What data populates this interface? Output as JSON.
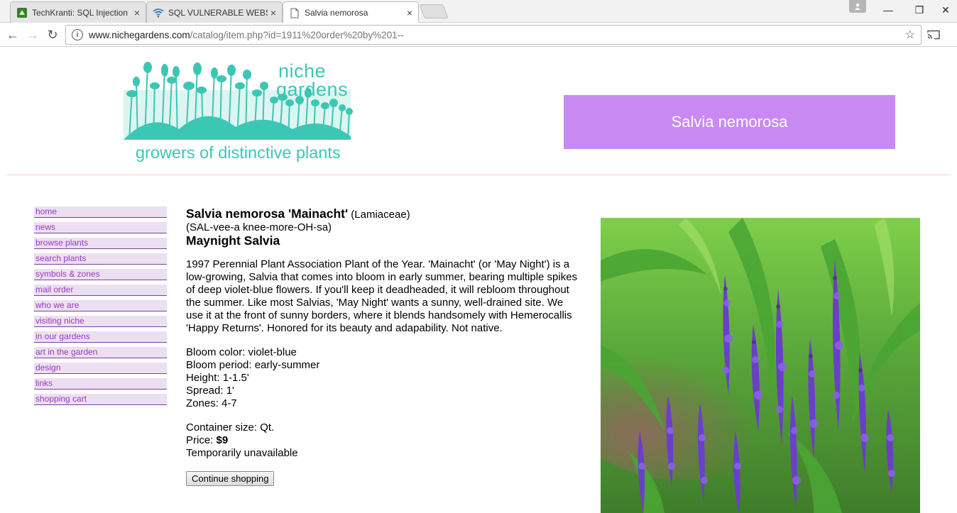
{
  "browser": {
    "tabs": [
      {
        "title": "TechKranti: SQL Injection",
        "close": "×",
        "active": false
      },
      {
        "title": "SQL VULNERABLE WEBSI",
        "close": "×",
        "active": false
      },
      {
        "title": "Salvia nemorosa",
        "close": "×",
        "active": true
      }
    ],
    "window_controls": {
      "minimize": "—",
      "restore": "❐",
      "close": "✕"
    },
    "nav": {
      "back": "←",
      "forward": "→",
      "reload": "↻"
    },
    "address": {
      "domain": "www.nichegardens.com",
      "path": "/catalog/item.php?id=1911%20order%20by%201--"
    },
    "bookmark_star": "☆"
  },
  "site": {
    "logo_name_line1": "niche",
    "logo_name_line2": "gardens",
    "logo_tagline": "growers of distinctive plants",
    "header_title": "Salvia nemorosa",
    "nav": [
      "home",
      "news",
      "browse plants",
      "search plants",
      "symbols & zones",
      "mail order",
      "who we are",
      "visiting niche",
      "in our gardens",
      "art in the garden",
      "design",
      "links",
      "shopping cart"
    ]
  },
  "plant": {
    "name": "Salvia nemorosa 'Mainacht'",
    "family": "(Lamiaceae)",
    "pronunciation": "(SAL-vee-a knee-more-OH-sa)",
    "common_name": "Maynight Salvia",
    "description": "1997 Perennial Plant Association Plant of the Year. 'Mainacht' (or 'May Night') is a low-growing, Salvia that comes into bloom in early summer, bearing multiple spikes of deep violet-blue flowers. If you'll keep it deadheaded, it will rebloom throughout the summer. Like most Salvias, 'May Night' wants a sunny, well-drained site. We use it at the front of sunny borders, where it blends handsomely with Hemerocallis 'Happy Returns'. Honored for its beauty and adapability. Not native.",
    "bloom_color": "Bloom color: violet-blue",
    "bloom_period": "Bloom period: early-summer",
    "height": "Height: 1-1.5'",
    "spread": "Spread: 1'",
    "zones": "Zones: 4-7",
    "container": "Container size: Qt.",
    "price_label": "Price: ",
    "price_value": "$9",
    "availability": "Temporarily unavailable",
    "continue_button": "Continue shopping"
  },
  "colors": {
    "accent_teal": "#3cc7b4",
    "header_purple": "#c88af2",
    "nav_link": "#9b38c4",
    "nav_bg": "#ecdff1",
    "divider_pink": "#f2c6ea"
  }
}
